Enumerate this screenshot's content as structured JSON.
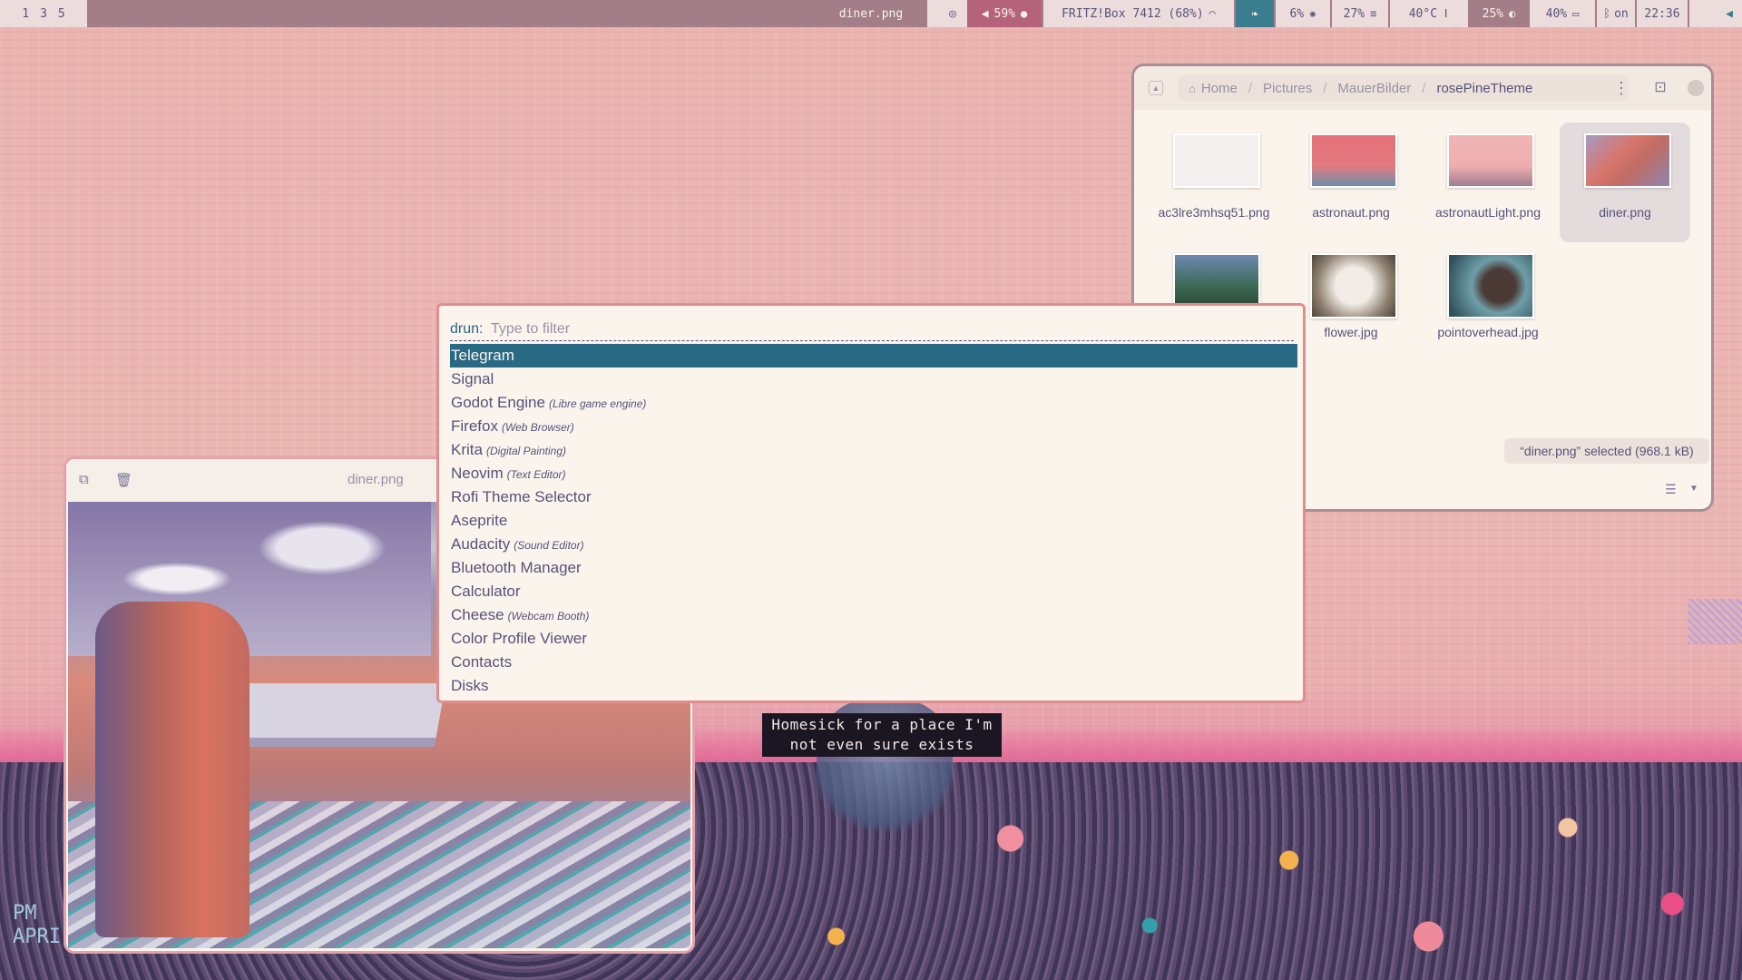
{
  "topbar": {
    "workspaces": [
      "1",
      "3",
      "5"
    ],
    "window_title": "diner.png",
    "volume": "59%",
    "network": "FRITZ!Box 7412 (68%)",
    "cpu": "6%",
    "memory": "27%",
    "temperature": "40°C",
    "backlight": "25%",
    "battery": "40%",
    "bluetooth": "on",
    "clock": "22:36",
    "colors": {
      "bar": "#a37d87",
      "light": "#ecdddc",
      "muted": "#b4637a",
      "teal": "#3a7d8f"
    }
  },
  "files": {
    "breadcrumbs": [
      "Home",
      "Pictures",
      "MauerBilder",
      "rosePineTheme"
    ],
    "items": [
      {
        "name": "ac3lre3mhsq51.png"
      },
      {
        "name": "astronaut.png"
      },
      {
        "name": "astronautLight.png"
      },
      {
        "name": "diner.png",
        "selected": true
      },
      {
        "name": ""
      },
      {
        "name": "flower.jpg"
      },
      {
        "name": "pointoverhead.jpg"
      }
    ],
    "status": "“diner.png” selected  (968.1 kB)"
  },
  "viewer": {
    "title": "diner.png"
  },
  "rofi": {
    "prompt": "drun:",
    "placeholder": "Type to filter",
    "items": [
      {
        "name": "Telegram",
        "sub": ""
      },
      {
        "name": "Signal",
        "sub": ""
      },
      {
        "name": "Godot Engine",
        "sub": "(Libre game engine)"
      },
      {
        "name": "Firefox",
        "sub": "(Web Browser)"
      },
      {
        "name": "Krita",
        "sub": "(Digital Painting)"
      },
      {
        "name": "Neovim",
        "sub": "(Text Editor)"
      },
      {
        "name": "Rofi Theme Selector",
        "sub": ""
      },
      {
        "name": "Aseprite",
        "sub": ""
      },
      {
        "name": "Audacity",
        "sub": "(Sound Editor)"
      },
      {
        "name": "Bluetooth Manager",
        "sub": ""
      },
      {
        "name": "Calculator",
        "sub": ""
      },
      {
        "name": "Cheese",
        "sub": "(Webcam Booth)"
      },
      {
        "name": "Color Profile Viewer",
        "sub": ""
      },
      {
        "name": "Contacts",
        "sub": ""
      },
      {
        "name": "Disks",
        "sub": ""
      }
    ],
    "selected_color": "#286983"
  },
  "wallpaper": {
    "caption_line1": "Homesick for a place I'm",
    "caption_line2": "not even sure exists",
    "corner_line1": "PM",
    "corner_line2": "APRI"
  }
}
